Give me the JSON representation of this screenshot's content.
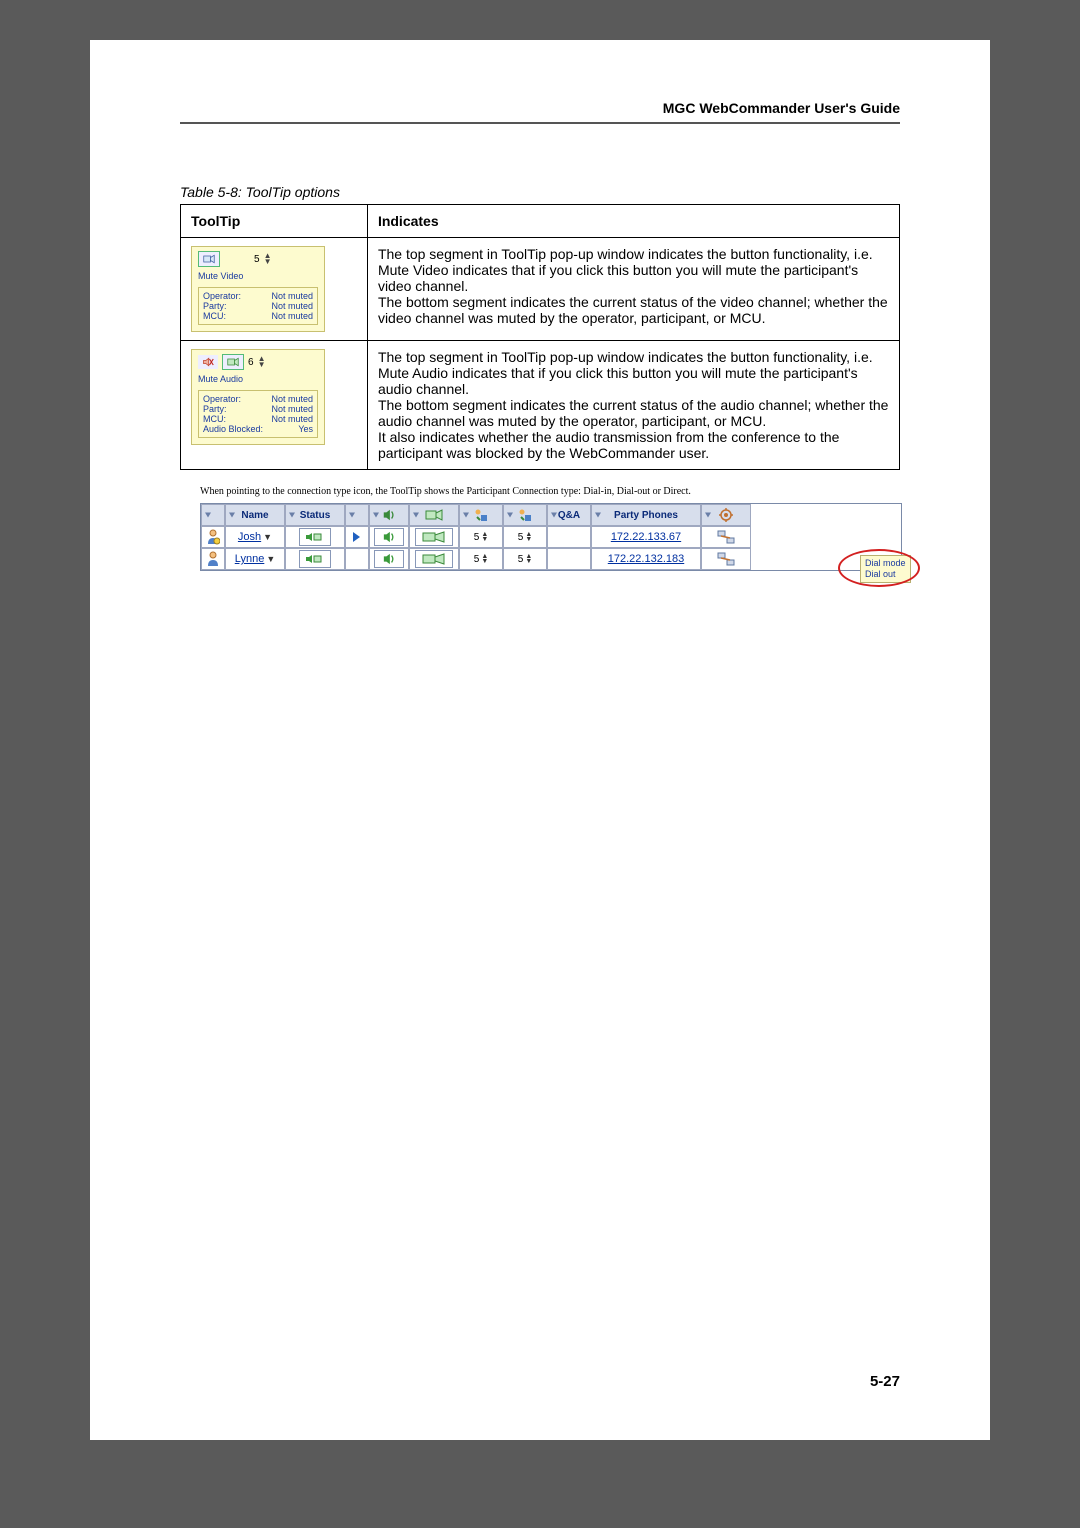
{
  "header": {
    "title": "MGC WebCommander User's Guide"
  },
  "tableCaption": "Table 5-8: ToolTip options",
  "columns": {
    "c1": "ToolTip",
    "c2": "Indicates"
  },
  "row1": {
    "top_num": "5",
    "tt_title": "Mute Video",
    "lines": {
      "op_lbl": "Operator:",
      "op_val": "Not muted",
      "party_lbl": "Party:",
      "party_val": "Not muted",
      "mcu_lbl": "MCU:",
      "mcu_val": "Not muted"
    },
    "desc_p1": "The top segment in ToolTip pop-up window indicates the button functionality, i.e. Mute Video indicates that if you click this button you will mute the participant's video channel.",
    "desc_p2": "The bottom segment indicates the current status of the video channel; whether the video channel was muted by the operator, participant, or MCU."
  },
  "row2": {
    "top_num": "6",
    "tt_title": "Mute Audio",
    "lines": {
      "op_lbl": "Operator:",
      "op_val": "Not muted",
      "party_lbl": "Party:",
      "party_val": "Not muted",
      "mcu_lbl": "MCU:",
      "mcu_val": "Not muted",
      "ab_lbl": "Audio Blocked:",
      "ab_val": "Yes"
    },
    "desc_p1": "The top segment in ToolTip pop-up window indicates the button functionality, i.e. Mute Audio indicates that if you click this button you will mute the participant's audio channel.",
    "desc_p2": "The bottom segment indicates the current status of the audio channel; whether the audio channel was muted by the operator, participant, or MCU.",
    "desc_p3": "It also indicates whether the audio transmission from the conference to the participant was blocked by the WebCommander user."
  },
  "caption2": "When pointing to the connection type icon, the ToolTip shows the Participant Connection type: Dial-in, Dial-out or Direct.",
  "gridHeaders": {
    "name": "Name",
    "status": "Status",
    "qa": "Q&A",
    "phones": "Party Phones"
  },
  "participants": [
    {
      "name": "Josh",
      "num1": "5",
      "num2": "5",
      "phone": "172.22.133.67"
    },
    {
      "name": "Lynne",
      "num1": "5",
      "num2": "5",
      "phone": "172.22.132.183"
    }
  ],
  "dialTooltip": {
    "l1": "Dial mode",
    "l2": "Dial out"
  },
  "pageNumber": "5-27"
}
